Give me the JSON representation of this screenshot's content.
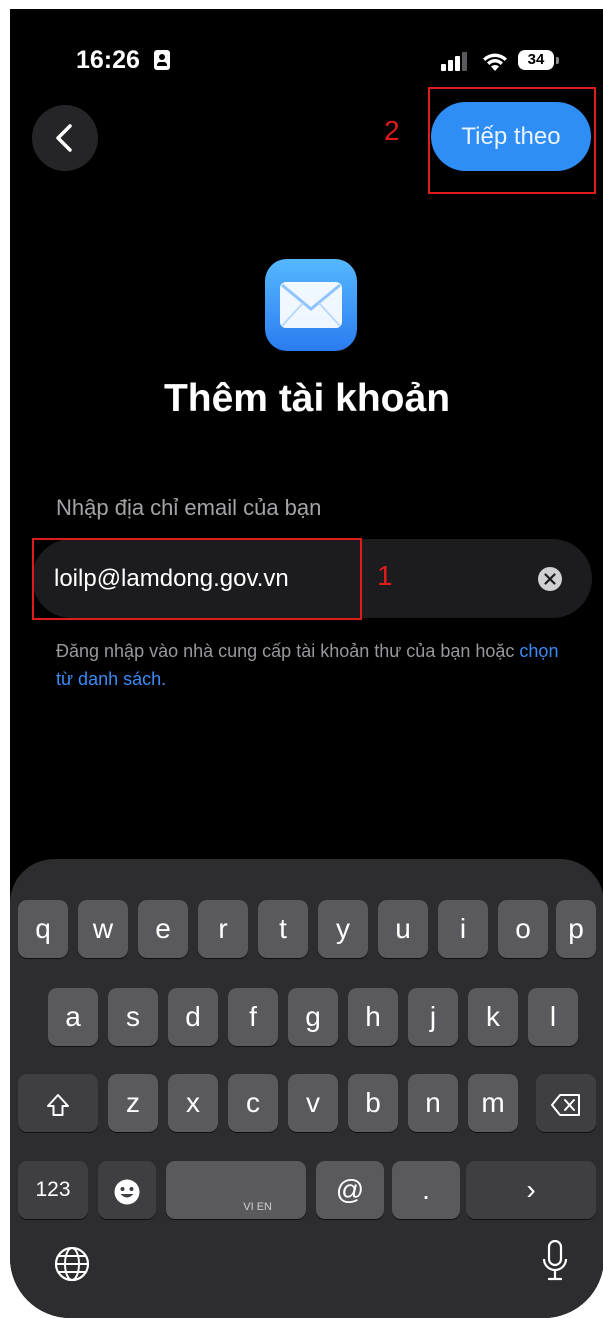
{
  "status": {
    "time": "16:26",
    "battery": "34"
  },
  "nav": {
    "next_label": "Tiếp theo"
  },
  "annotations": {
    "step1": "1",
    "step2": "2"
  },
  "main": {
    "title": "Thêm tài khoản",
    "field_label": "Nhập địa chỉ email của bạn",
    "email_value": "loilp@lamdong.gov.vn",
    "helper_text": "Đăng nhập vào nhà cung cấp tài khoản thư của bạn hoặc",
    "helper_link": "chọn từ danh sách."
  },
  "keyboard": {
    "row1": [
      "q",
      "w",
      "e",
      "r",
      "t",
      "y",
      "u",
      "i",
      "o",
      "p"
    ],
    "row2": [
      "a",
      "s",
      "d",
      "f",
      "g",
      "h",
      "j",
      "k",
      "l"
    ],
    "row3": [
      "z",
      "x",
      "c",
      "v",
      "b",
      "n",
      "m"
    ],
    "numbers_key": "123",
    "at_key": "@",
    "period_key": ".",
    "return_key": "›",
    "space_lang": "VI EN"
  },
  "colors": {
    "accent": "#2f8ef5",
    "annotation": "#e01b1b",
    "background": "#000000",
    "keyboard_bg": "#2d2d30"
  }
}
